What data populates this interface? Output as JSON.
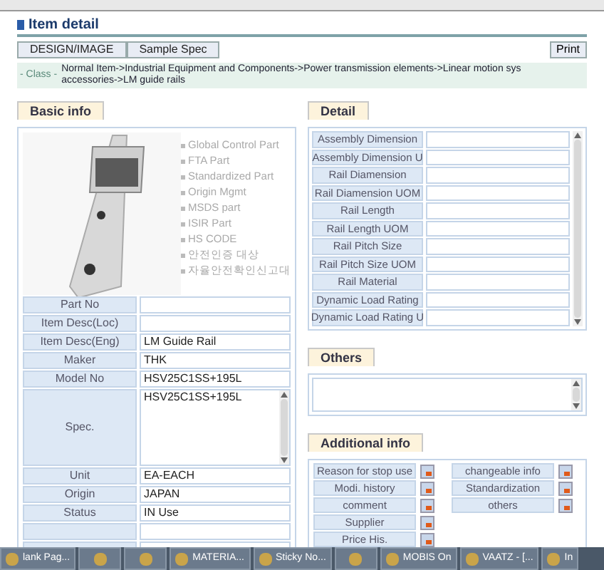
{
  "header": {
    "title": "Item detail"
  },
  "toolbar": {
    "buttons": [
      "DESIGN/IMAGE",
      "Sample Spec"
    ],
    "print": "Print"
  },
  "class_bar": {
    "label": "- Class -",
    "lines": [
      "Normal Item->Industrial Equipment and Components->Power transmission elements->Linear motion sys",
      "accessories->LM guide rails"
    ]
  },
  "basic_info": {
    "tab": "Basic info",
    "flags": [
      "Global Control Part",
      "FTA Part",
      "Standardized Part",
      "Origin Mgmt",
      "MSDS part",
      "ISIR Part",
      "HS CODE",
      "안전인증 대상",
      "자율안전확인신고대"
    ],
    "fields": [
      {
        "kind": "input",
        "label": "Part No"
      },
      {
        "kind": "input",
        "label": "Item Desc(Loc)"
      },
      {
        "kind": "input",
        "label": "Item Desc(Eng)",
        "value": "LM Guide Rail"
      },
      {
        "kind": "input",
        "label": "Maker",
        "value": "THK"
      },
      {
        "kind": "input",
        "label": "Model No",
        "value": "HSV25C1SS+195L"
      },
      {
        "kind": "textarea",
        "label": "Spec.",
        "value": "HSV25C1SS+195L"
      },
      {
        "kind": "input",
        "label": "Unit",
        "value": "EA-EACH"
      },
      {
        "kind": "input",
        "label": "Origin",
        "value": "JAPAN"
      },
      {
        "kind": "input",
        "label": "Status",
        "value": "IN Use"
      },
      {
        "kind": "input"
      },
      {
        "kind": "input"
      }
    ]
  },
  "detail": {
    "tab": "Detail",
    "rows": [
      "Assembly Dimension",
      "Assembly Dimension U",
      "Rail Diamension",
      "Rail Diamension UOM",
      "Rail Length",
      "Rail Length UOM",
      "Rail Pitch Size",
      "Rail Pitch Size UOM",
      "Rail Material",
      "Dynamic Load Rating",
      "Dynamic Load Rating U"
    ]
  },
  "others": {
    "tab": "Others"
  },
  "additional_info": {
    "tab": "Additional info",
    "column_1": [
      "Reason for stop use",
      "Modi. history",
      "comment",
      "Supplier",
      "Price His."
    ],
    "column_2": [
      "changeable info",
      "Standardization",
      "others"
    ]
  },
  "taskbar": [
    {
      "kind": "labeled",
      "label": "lank Pag..."
    },
    {
      "kind": "icon"
    },
    {
      "kind": "icon"
    },
    {
      "kind": "labeled",
      "label": "MATERIA..."
    },
    {
      "kind": "labeled",
      "label": "Sticky No..."
    },
    {
      "kind": "icon"
    },
    {
      "kind": "labeled",
      "label": "MOBIS On"
    },
    {
      "kind": "labeled",
      "label": "VAATZ - [..."
    },
    {
      "kind": "labeled",
      "label": "In"
    }
  ]
}
